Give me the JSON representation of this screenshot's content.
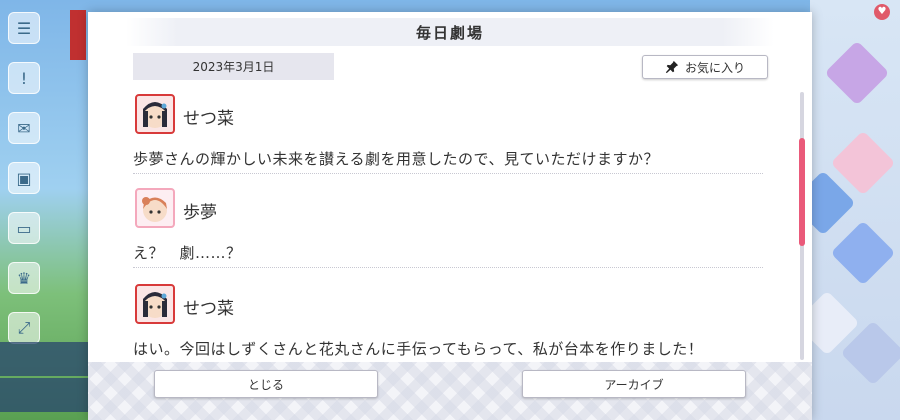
{
  "dialog": {
    "title": "毎日劇場",
    "date": "2023年3月1日",
    "favorite_label": "お気に入り"
  },
  "entries": [
    {
      "speaker": "せつ菜",
      "avatar": "setsuna-avatar",
      "text": "歩夢さんの輝かしい未来を讃える劇を用意したので、見ていただけますか？"
    },
    {
      "speaker": "歩夢",
      "avatar": "ayumu-avatar",
      "text": "え？　劇……？"
    },
    {
      "speaker": "せつ菜",
      "avatar": "setsuna-avatar",
      "text": "はい。今回はしずくさんと花丸さんに手伝ってもらって、私が台本を作りました！"
    }
  ],
  "footer": {
    "close_label": "とじる",
    "archive_label": "アーカイブ"
  },
  "colors": {
    "accent_pink": "#ea5a7a",
    "setsuna_frame": "#d83a3a",
    "ayumu_frame": "#f4a8bc"
  }
}
